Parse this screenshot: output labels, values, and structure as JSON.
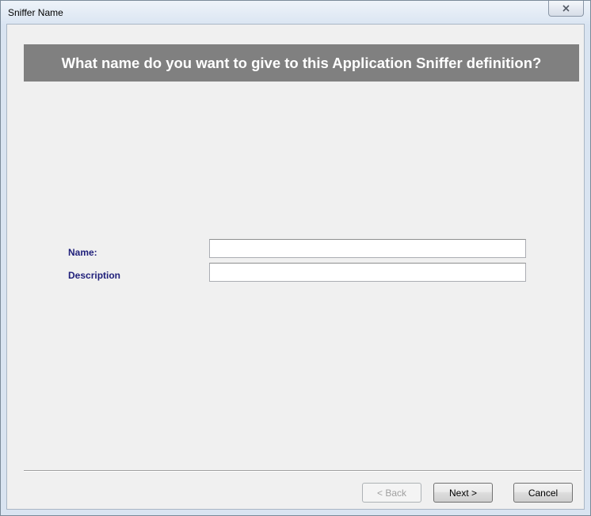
{
  "window": {
    "title": "Sniffer Name",
    "close_icon": "close-icon"
  },
  "header": {
    "text": "What name do you want to give to this Application Sniffer definition?"
  },
  "form": {
    "name_label": "Name:",
    "name_value": "",
    "description_label": "Description",
    "description_value": ""
  },
  "buttons": {
    "back_label": "< Back",
    "back_enabled": false,
    "next_label": "Next >",
    "cancel_label": "Cancel"
  },
  "colors": {
    "banner_bg": "#808080",
    "banner_text": "#ffffff",
    "label_text": "#1f1f7a",
    "dialog_bg": "#f0f0f0"
  }
}
